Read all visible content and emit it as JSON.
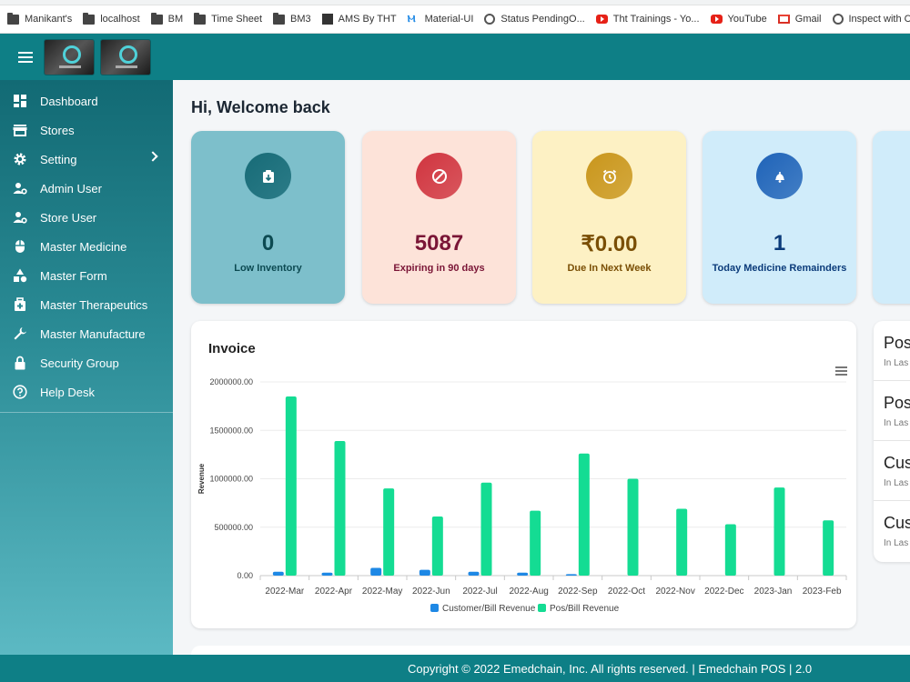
{
  "bookmarks": [
    {
      "label": "Manikant's",
      "icon": "folder"
    },
    {
      "label": "localhost",
      "icon": "folder"
    },
    {
      "label": "BM",
      "icon": "folder"
    },
    {
      "label": "Time Sheet",
      "icon": "folder"
    },
    {
      "label": "BM3",
      "icon": "folder"
    },
    {
      "label": "AMS By THT",
      "icon": "ams"
    },
    {
      "label": "Material-UI",
      "icon": "mui"
    },
    {
      "label": "Status PendingO...",
      "icon": "globe"
    },
    {
      "label": "Tht Trainings - Yo...",
      "icon": "yt"
    },
    {
      "label": "YouTube",
      "icon": "yt"
    },
    {
      "label": "Gmail",
      "icon": "gmail"
    },
    {
      "label": "Inspect with Chro...",
      "icon": "globe"
    }
  ],
  "sidebar": {
    "items": [
      {
        "label": "Dashboard",
        "icon": "dashboard-icon",
        "has_chevron": false
      },
      {
        "label": "Stores",
        "icon": "store-icon",
        "has_chevron": false
      },
      {
        "label": "Setting",
        "icon": "gear-icon",
        "has_chevron": true
      },
      {
        "label": "Admin User",
        "icon": "admin-user-icon",
        "has_chevron": false
      },
      {
        "label": "Store User",
        "icon": "store-user-icon",
        "has_chevron": false
      },
      {
        "label": "Master Medicine",
        "icon": "mouse-icon",
        "has_chevron": false
      },
      {
        "label": "Master Form",
        "icon": "shapes-icon",
        "has_chevron": false
      },
      {
        "label": "Master Therapeutics",
        "icon": "medical-bag-icon",
        "has_chevron": false
      },
      {
        "label": "Master Manufacture",
        "icon": "wrench-icon",
        "has_chevron": false
      },
      {
        "label": "Security Group",
        "icon": "lock-icon",
        "has_chevron": false
      },
      {
        "label": "Help Desk",
        "icon": "help-icon",
        "has_chevron": false
      }
    ]
  },
  "main": {
    "welcome": "Hi, Welcome back",
    "cards": [
      {
        "value": "0",
        "label": "Low Inventory",
        "icon": "inventory-icon",
        "bg": "#7dbfcb",
        "circle": "#176b77",
        "text": "#0c4a52"
      },
      {
        "value": "5087",
        "label": "Expiring in 90 days",
        "icon": "block-icon",
        "bg": "#fde3d9",
        "circle": "#d0343f",
        "text": "#7a1536"
      },
      {
        "value": "₹0.00",
        "label": "Due In Next Week",
        "icon": "alarm-icon",
        "bg": "#fdf1c4",
        "circle": "#c9961c",
        "text": "#7a4f06"
      },
      {
        "value": "1",
        "label": "Today Medicine Remainders",
        "icon": "bell-icon",
        "bg": "#d0ecfa",
        "circle": "#1f63b8",
        "text": "#0b3b7a"
      }
    ],
    "right_list": [
      {
        "title": "Pos",
        "sub": "In Las"
      },
      {
        "title": "Pos",
        "sub": "In Las"
      },
      {
        "title": "Cus",
        "sub": "In Las"
      },
      {
        "title": "Cus",
        "sub": "In Las"
      }
    ]
  },
  "chart_data": {
    "type": "bar",
    "title": "Invoice",
    "ylabel": "Revenue",
    "xlabel": "",
    "ylim": [
      0,
      2000000
    ],
    "ytick_labels": [
      "0.00",
      "500000.00",
      "1000000.00",
      "1500000.00",
      "2000000.00"
    ],
    "categories": [
      "2022-Mar",
      "2022-Apr",
      "2022-May",
      "2022-Jun",
      "2022-Jul",
      "2022-Aug",
      "2022-Sep",
      "2022-Oct",
      "2022-Nov",
      "2022-Dec",
      "2023-Jan",
      "2023-Feb"
    ],
    "series": [
      {
        "name": "Customer/Bill Revenue",
        "color": "#1e88e5",
        "values": [
          40000,
          30000,
          80000,
          60000,
          40000,
          30000,
          15000,
          0,
          0,
          0,
          0,
          0
        ]
      },
      {
        "name": "Pos/Bill Revenue",
        "color": "#14dc93",
        "values": [
          1850000,
          1390000,
          900000,
          610000,
          960000,
          670000,
          1260000,
          1000000,
          690000,
          530000,
          910000,
          570000
        ]
      }
    ],
    "legend_position": "bottom"
  },
  "footer": {
    "text": "Copyright © 2022 Emedchain, Inc. All rights reserved. | Emedchain POS | 2.0"
  }
}
